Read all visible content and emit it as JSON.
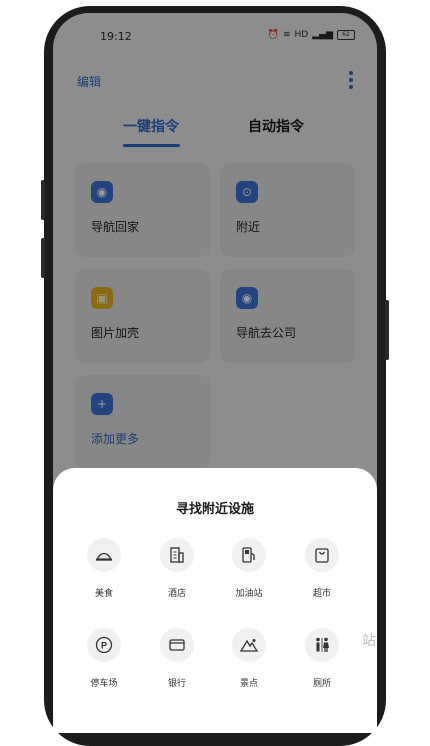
{
  "status": {
    "time": "19:12",
    "network": "HD",
    "battery": "62"
  },
  "header": {
    "edit_label": "编辑"
  },
  "tabs": [
    {
      "label": "一键指令",
      "active": true
    },
    {
      "label": "自动指令",
      "active": false
    }
  ],
  "commands": [
    {
      "label": "导航回家",
      "icon": "navigation-target-icon",
      "color": "#3a72d4"
    },
    {
      "label": "附近",
      "icon": "location-pin-icon",
      "color": "#3a72d4"
    },
    {
      "label": "图片加壳",
      "icon": "image-frame-icon",
      "color": "#e6b321"
    },
    {
      "label": "导航去公司",
      "icon": "navigation-target-icon",
      "color": "#3a72d4"
    },
    {
      "label": "添加更多",
      "icon": "plus-icon",
      "color": "#3a72d4"
    }
  ],
  "sheet": {
    "title": "寻找附近设施",
    "facilities": [
      {
        "label": "美食",
        "icon": "food-dish-icon"
      },
      {
        "label": "酒店",
        "icon": "hotel-building-icon"
      },
      {
        "label": "加油站",
        "icon": "gas-pump-icon"
      },
      {
        "label": "超市",
        "icon": "supermarket-bag-icon"
      },
      {
        "label": "停车场",
        "icon": "parking-icon"
      },
      {
        "label": "银行",
        "icon": "bank-card-icon"
      },
      {
        "label": "景点",
        "icon": "mountain-scenery-icon"
      },
      {
        "label": "厕所",
        "icon": "restroom-icon"
      }
    ]
  },
  "watermark": "站"
}
